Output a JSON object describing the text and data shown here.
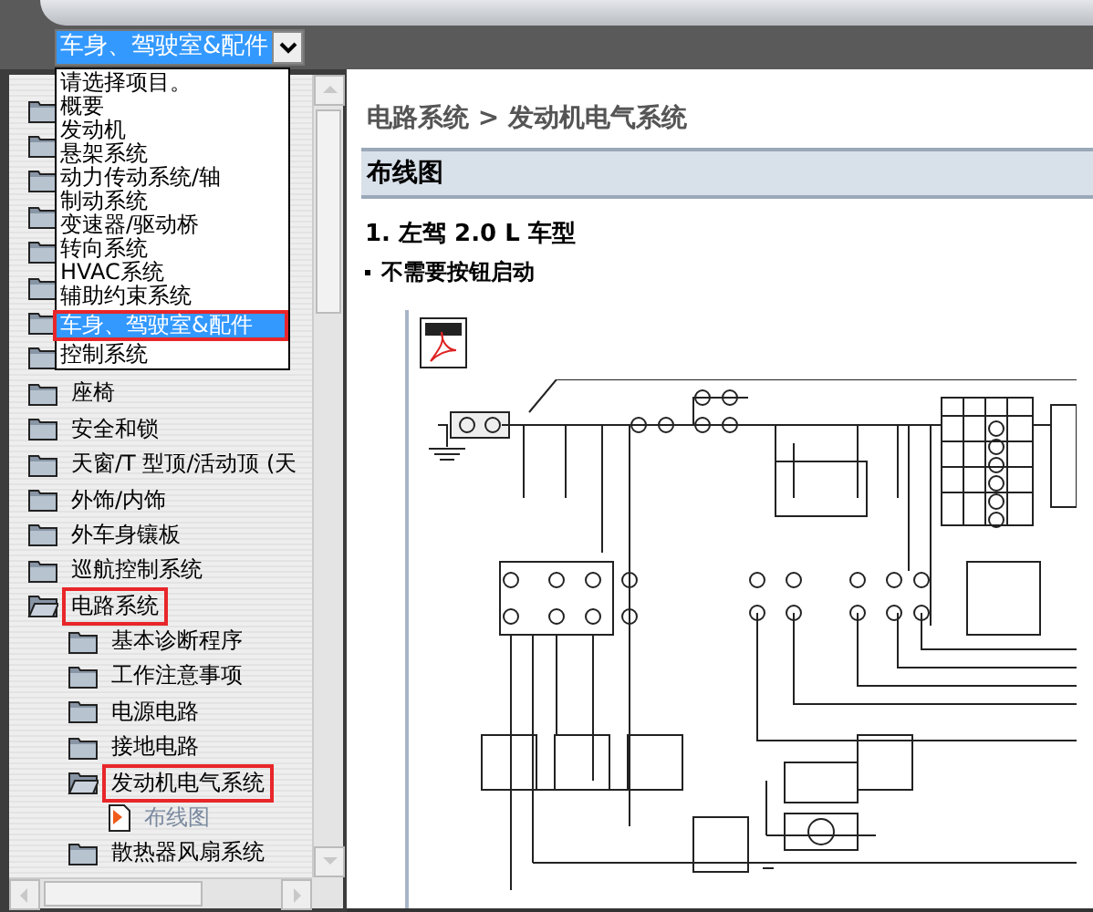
{
  "selector": {
    "value": "车身、驾驶室&配件",
    "options": [
      {
        "label": "请选择项目。",
        "selected": false,
        "highlighted": false
      },
      {
        "label": "概要",
        "selected": false,
        "highlighted": false
      },
      {
        "label": "发动机",
        "selected": false,
        "highlighted": false
      },
      {
        "label": "悬架系统",
        "selected": false,
        "highlighted": false
      },
      {
        "label": "动力传动系统/轴",
        "selected": false,
        "highlighted": false
      },
      {
        "label": "制动系统",
        "selected": false,
        "highlighted": false
      },
      {
        "label": "变速器/驱动桥",
        "selected": false,
        "highlighted": false
      },
      {
        "label": "转向系统",
        "selected": false,
        "highlighted": false
      },
      {
        "label": "HVAC系统",
        "selected": false,
        "highlighted": false
      },
      {
        "label": "辅助约束系统",
        "selected": false,
        "highlighted": false
      },
      {
        "label": "车身、驾驶室&配件",
        "selected": true,
        "highlighted": true
      },
      {
        "label": "控制系统",
        "selected": false,
        "highlighted": false
      }
    ]
  },
  "tree": [
    {
      "kind": "folder"
    },
    {
      "kind": "folder"
    },
    {
      "kind": "folder"
    },
    {
      "kind": "folder"
    },
    {
      "kind": "folder"
    },
    {
      "kind": "folder"
    },
    {
      "kind": "folder"
    },
    {
      "kind": "folder"
    },
    {
      "kind": "folder",
      "label": "座椅",
      "expanded": false,
      "highlighted": false
    },
    {
      "kind": "folder",
      "label": "安全和锁",
      "expanded": false,
      "highlighted": false
    },
    {
      "kind": "folder",
      "label": "天窗/T 型顶/活动顶 (天",
      "expanded": false,
      "highlighted": false
    },
    {
      "kind": "folder",
      "label": "外饰/内饰",
      "expanded": false,
      "highlighted": false
    },
    {
      "kind": "folder",
      "label": "外车身镶板",
      "expanded": false,
      "highlighted": false
    },
    {
      "kind": "folder",
      "label": "巡航控制系统",
      "expanded": false,
      "highlighted": false
    },
    {
      "kind": "folder",
      "label": "电路系统",
      "expanded": true,
      "highlighted": true,
      "children": [
        {
          "kind": "folder",
          "label": "基本诊断程序",
          "expanded": false,
          "highlighted": false
        },
        {
          "kind": "folder",
          "label": "工作注意事项",
          "expanded": false,
          "highlighted": false
        },
        {
          "kind": "folder",
          "label": "电源电路",
          "expanded": false,
          "highlighted": false
        },
        {
          "kind": "folder",
          "label": "接地电路",
          "expanded": false,
          "highlighted": false
        },
        {
          "kind": "folder",
          "label": "发动机电气系统",
          "expanded": true,
          "highlighted": true,
          "children": [
            {
              "kind": "page",
              "label": "布线图",
              "highlighted": false
            }
          ]
        },
        {
          "kind": "folder",
          "label": "散热器风扇系统",
          "expanded": false,
          "highlighted": false
        }
      ]
    }
  ],
  "breadcrumb": "电路系统 > 发动机电气系统",
  "section_title": "布线图",
  "heading": "1. 左驾 2.0 L 车型",
  "bullet": "不需要按钮启动"
}
